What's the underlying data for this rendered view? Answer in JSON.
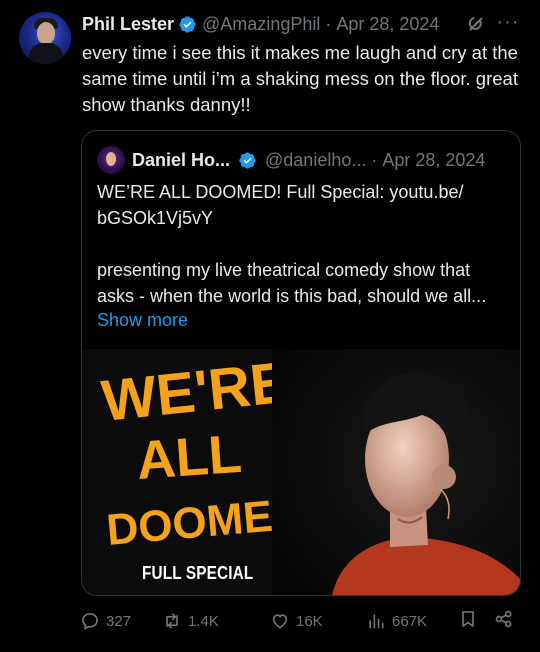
{
  "tweet": {
    "author_name": "Phil Lester",
    "handle": "@AmazingPhil",
    "date": "Apr 28, 2024",
    "text": "every time i see this it makes me laugh and cry at the same time until i’m a shaking mess on the floor. great show thanks danny!!"
  },
  "quote": {
    "author_name": "Daniel Ho...",
    "handle": "@danielho...",
    "date": "Apr 28, 2024",
    "text_line1": "WE’RE ALL DOOMED! Full Special: youtu.be/",
    "text_line2": "bGSOk1Vj5vY",
    "text_body": "presenting my live theatrical comedy show that asks - when the world is this bad, should we all...",
    "show_more": "Show more",
    "media": {
      "title_line1": "WE'RE",
      "title_line2": "ALL",
      "title_line3": "DOOMED!",
      "subtitle": "FULL SPECIAL"
    }
  },
  "actions": {
    "replies": "327",
    "retweets": "1.4K",
    "likes": "16K",
    "views": "667K"
  },
  "icons": {
    "verified": "verified-badge-icon",
    "grok": "grok-icon",
    "more": "more-icon",
    "reply": "reply-icon",
    "retweet": "retweet-icon",
    "like": "heart-icon",
    "views": "views-icon",
    "bookmark": "bookmark-icon",
    "share": "share-icon"
  },
  "colors": {
    "background": "#000000",
    "text": "#e7e9ea",
    "muted": "#71767b",
    "link": "#1d9bf0",
    "verified": "#1d9bf0",
    "title_orange": "#f5a21b"
  }
}
